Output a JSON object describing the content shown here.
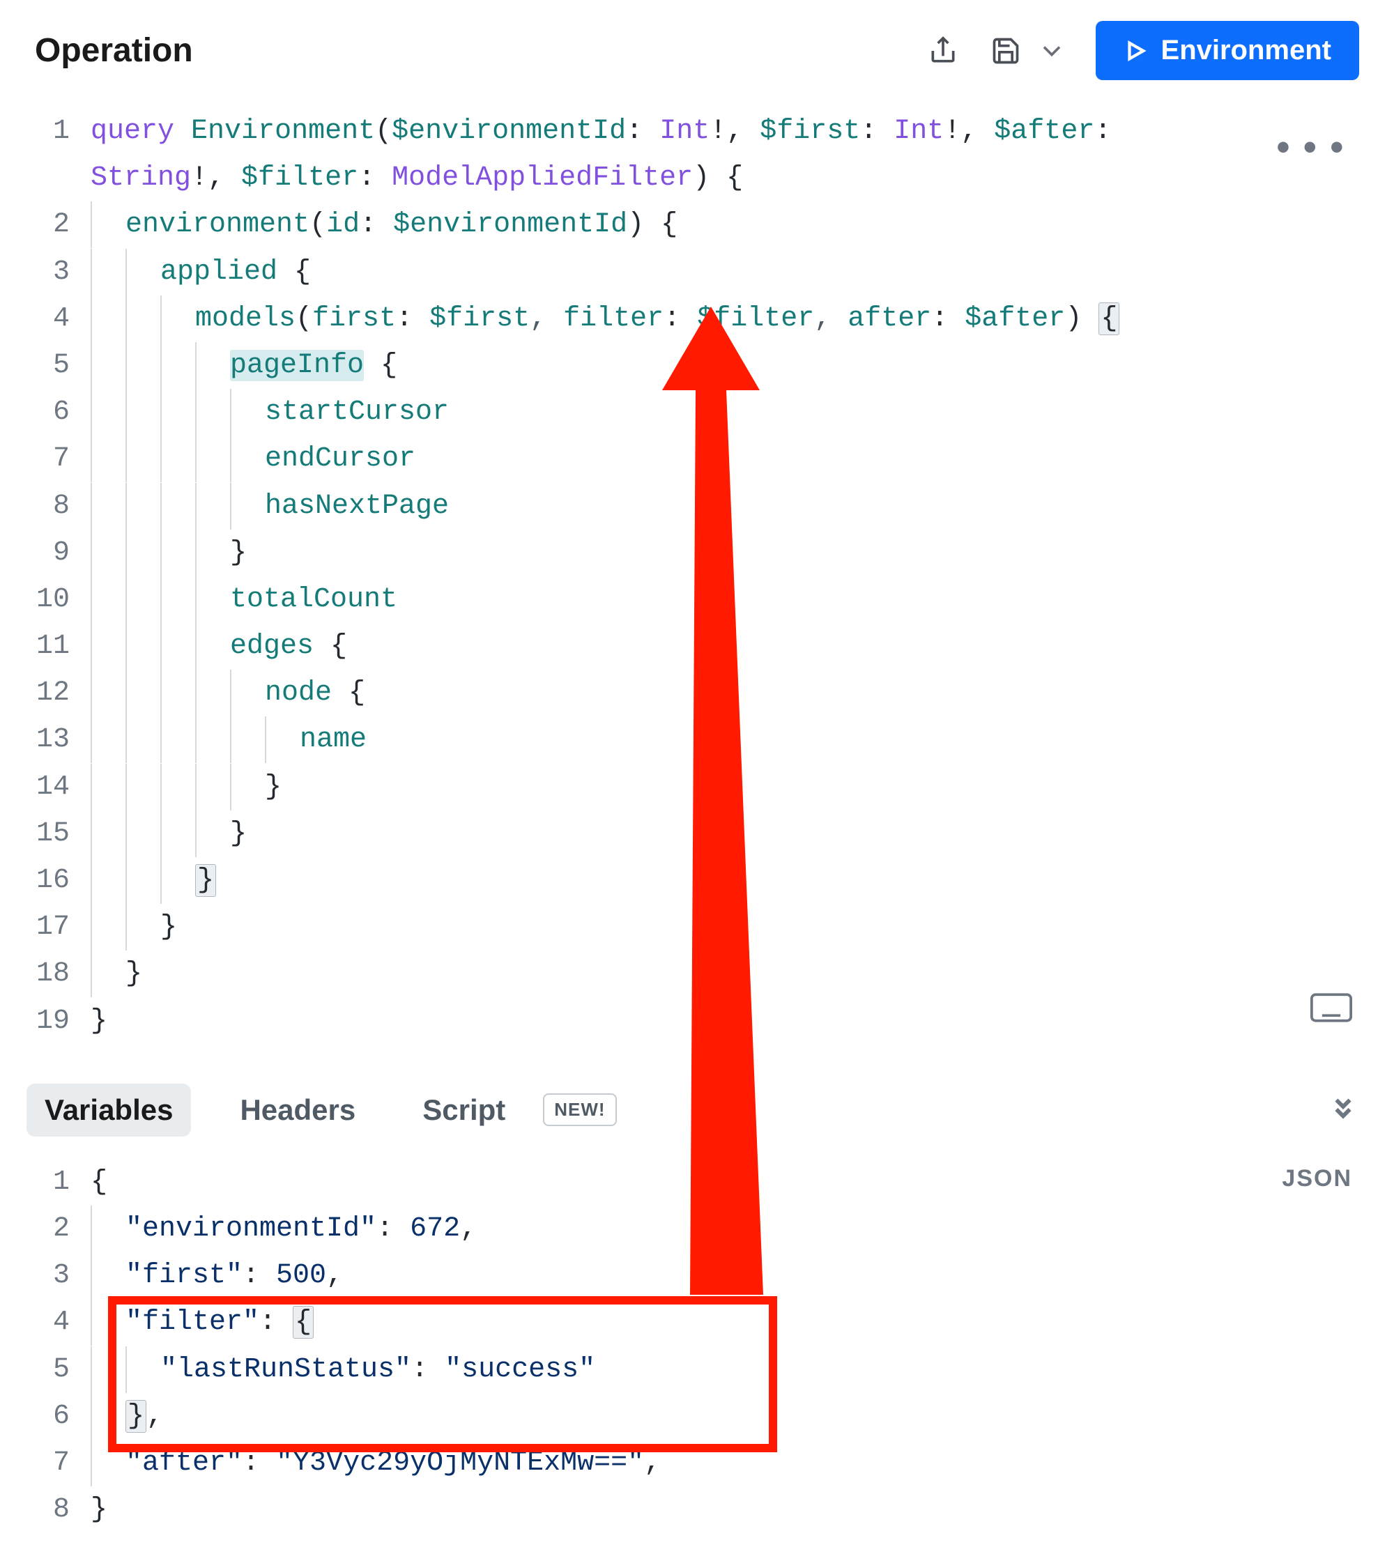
{
  "header": {
    "title": "Operation",
    "run_label": "Environment"
  },
  "tabs": {
    "variables": "Variables",
    "headers": "Headers",
    "script": "Script",
    "new_badge": "NEW!",
    "json_label": "JSON"
  },
  "operation_code": {
    "lines": [
      {
        "n": "1",
        "indent": 0,
        "tokens": [
          [
            "kw",
            "query"
          ],
          [
            "pn",
            " "
          ],
          [
            "fn",
            "Environment"
          ],
          [
            "pn",
            "("
          ],
          [
            "fn",
            "$environmentId"
          ],
          [
            "pn",
            ": "
          ],
          [
            "kw",
            "Int"
          ],
          [
            "pn",
            "!, "
          ],
          [
            "fn",
            "$first"
          ],
          [
            "pn",
            ": "
          ],
          [
            "kw",
            "Int"
          ],
          [
            "pn",
            "!, "
          ],
          [
            "fn",
            "$after"
          ],
          [
            "pn",
            ": "
          ]
        ]
      },
      {
        "n": "",
        "indent": 0,
        "tokens": [
          [
            "kw",
            "String"
          ],
          [
            "pn",
            "!, "
          ],
          [
            "fn",
            "$filter"
          ],
          [
            "pn",
            ": "
          ],
          [
            "kw",
            "ModelAppliedFilter"
          ],
          [
            "pn",
            ") {"
          ]
        ]
      },
      {
        "n": "2",
        "indent": 1,
        "tokens": [
          [
            "fn",
            "environment"
          ],
          [
            "pn",
            "("
          ],
          [
            "fn",
            "id"
          ],
          [
            "pn",
            ": "
          ],
          [
            "fn",
            "$environmentId"
          ],
          [
            "pn",
            ") {"
          ]
        ]
      },
      {
        "n": "3",
        "indent": 2,
        "tokens": [
          [
            "fn",
            "applied"
          ],
          [
            "pn",
            " {"
          ]
        ]
      },
      {
        "n": "4",
        "indent": 3,
        "tokens": [
          [
            "fn",
            "models"
          ],
          [
            "pn",
            "("
          ],
          [
            "fn",
            "first"
          ],
          [
            "pn",
            ": "
          ],
          [
            "fn",
            "$first"
          ],
          [
            "gn",
            ", "
          ],
          [
            "fn",
            "filter"
          ],
          [
            "pn",
            ": "
          ],
          [
            "fn",
            "$filter"
          ],
          [
            "gn",
            ", "
          ],
          [
            "fn",
            "after"
          ],
          [
            "pn",
            ": "
          ],
          [
            "fn",
            "$after"
          ],
          [
            "pn",
            ") "
          ],
          [
            "hl",
            "{"
          ]
        ]
      },
      {
        "n": "5",
        "indent": 4,
        "tokens": [
          [
            "sel",
            "pageInfo"
          ],
          [
            "pn",
            " {"
          ]
        ]
      },
      {
        "n": "6",
        "indent": 5,
        "tokens": [
          [
            "fn",
            "startCursor"
          ]
        ]
      },
      {
        "n": "7",
        "indent": 5,
        "tokens": [
          [
            "fn",
            "endCursor"
          ]
        ]
      },
      {
        "n": "8",
        "indent": 5,
        "tokens": [
          [
            "fn",
            "hasNextPage"
          ]
        ]
      },
      {
        "n": "9",
        "indent": 4,
        "tokens": [
          [
            "pn",
            "}"
          ]
        ]
      },
      {
        "n": "10",
        "indent": 4,
        "tokens": [
          [
            "fn",
            "totalCount"
          ]
        ]
      },
      {
        "n": "11",
        "indent": 4,
        "tokens": [
          [
            "fn",
            "edges"
          ],
          [
            "pn",
            " {"
          ]
        ]
      },
      {
        "n": "12",
        "indent": 5,
        "tokens": [
          [
            "fn",
            "node"
          ],
          [
            "pn",
            " {"
          ]
        ]
      },
      {
        "n": "13",
        "indent": 6,
        "tokens": [
          [
            "fn",
            "name"
          ]
        ]
      },
      {
        "n": "14",
        "indent": 5,
        "tokens": [
          [
            "pn",
            "}"
          ]
        ]
      },
      {
        "n": "15",
        "indent": 4,
        "tokens": [
          [
            "pn",
            "}"
          ]
        ]
      },
      {
        "n": "16",
        "indent": 3,
        "tokens": [
          [
            "hl",
            "}"
          ]
        ]
      },
      {
        "n": "17",
        "indent": 2,
        "tokens": [
          [
            "pn",
            "}"
          ]
        ]
      },
      {
        "n": "18",
        "indent": 1,
        "tokens": [
          [
            "pn",
            "}"
          ]
        ]
      },
      {
        "n": "19",
        "indent": 0,
        "tokens": [
          [
            "pn",
            "}"
          ]
        ]
      }
    ]
  },
  "variables_code": {
    "lines": [
      {
        "n": "1",
        "indent": 0,
        "tokens": [
          [
            "pn",
            "{"
          ]
        ]
      },
      {
        "n": "2",
        "indent": 1,
        "tokens": [
          [
            "str",
            "\"environmentId\""
          ],
          [
            "pn",
            ": "
          ],
          [
            "num",
            "672"
          ],
          [
            "pn",
            ","
          ]
        ]
      },
      {
        "n": "3",
        "indent": 1,
        "tokens": [
          [
            "str",
            "\"first\""
          ],
          [
            "pn",
            ": "
          ],
          [
            "num",
            "500"
          ],
          [
            "pn",
            ","
          ]
        ]
      },
      {
        "n": "4",
        "indent": 1,
        "tokens": [
          [
            "str",
            "\"filter\""
          ],
          [
            "pn",
            ": "
          ],
          [
            "hl",
            "{"
          ]
        ]
      },
      {
        "n": "5",
        "indent": 2,
        "tokens": [
          [
            "str",
            "\"lastRunStatus\""
          ],
          [
            "pn",
            ": "
          ],
          [
            "str",
            "\"success\""
          ]
        ]
      },
      {
        "n": "6",
        "indent": 1,
        "tokens": [
          [
            "hl",
            "}"
          ],
          [
            "pn",
            ","
          ]
        ]
      },
      {
        "n": "7",
        "indent": 1,
        "tokens": [
          [
            "str",
            "\"after\""
          ],
          [
            "pn",
            ": "
          ],
          [
            "str",
            "\"Y3Vyc29yOjMyNTExMw==\""
          ],
          [
            "pn",
            ","
          ]
        ]
      },
      {
        "n": "8",
        "indent": 0,
        "tokens": [
          [
            "pn",
            "}"
          ]
        ]
      }
    ]
  },
  "variables_values": {
    "environmentId": 672,
    "first": 500,
    "filter": {
      "lastRunStatus": "success"
    },
    "after": "Y3Vyc29yOjMyNTExMw=="
  }
}
